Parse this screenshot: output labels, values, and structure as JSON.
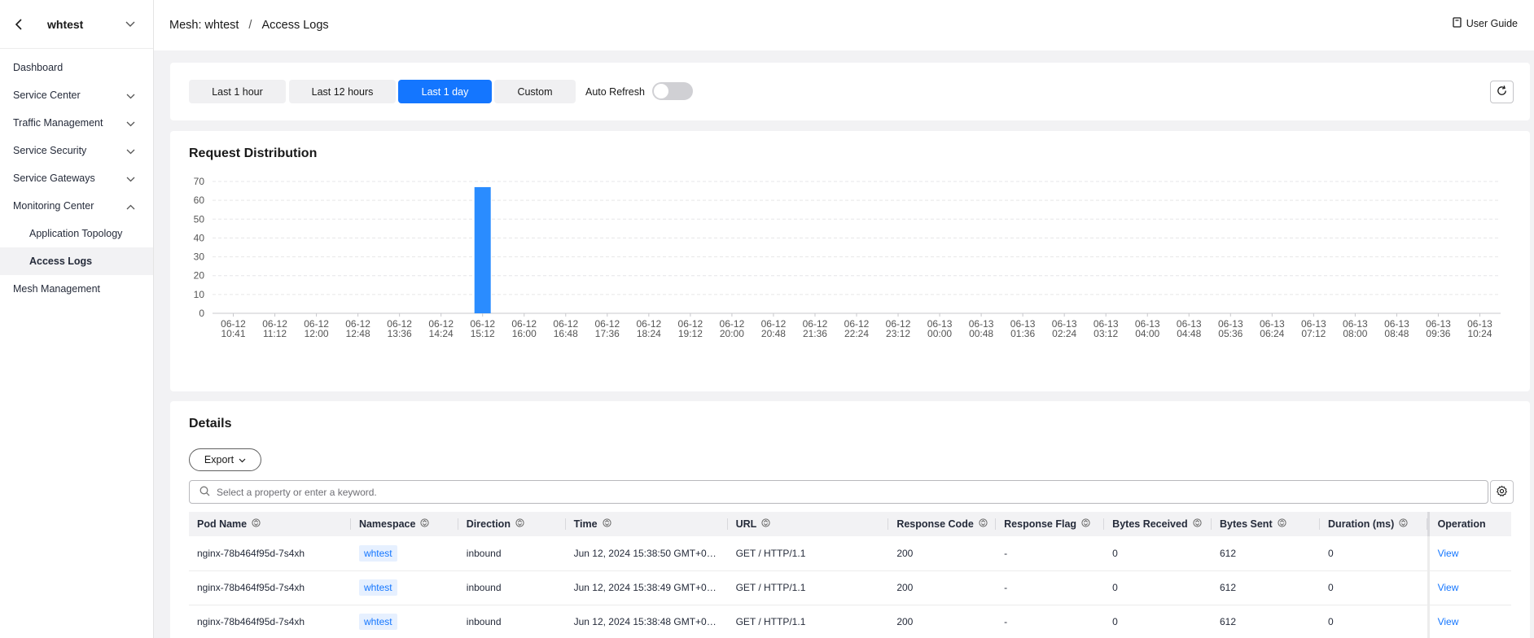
{
  "sidebar": {
    "title": "whtest",
    "items": [
      {
        "label": "Dashboard",
        "expand": ""
      },
      {
        "label": "Service Center",
        "expand": "down"
      },
      {
        "label": "Traffic Management",
        "expand": "down"
      },
      {
        "label": "Service Security",
        "expand": "down"
      },
      {
        "label": "Service Gateways",
        "expand": "down"
      },
      {
        "label": "Monitoring Center",
        "expand": "up"
      },
      {
        "label": "Application Topology",
        "sub": true
      },
      {
        "label": "Access Logs",
        "sub": true,
        "active": true
      },
      {
        "label": "Mesh Management",
        "expand": ""
      }
    ]
  },
  "breadcrumb": {
    "mesh": "Mesh: whtest",
    "separator": "/",
    "page": "Access Logs"
  },
  "user_guide": "User Guide",
  "filters": {
    "options": [
      "Last 1 hour",
      "Last 12 hours",
      "Last 1 day",
      "Custom"
    ],
    "active_index": 2,
    "auto_refresh_label": "Auto Refresh",
    "auto_refresh_on": false
  },
  "chart_section": {
    "title": "Request Distribution"
  },
  "chart_data": {
    "type": "bar",
    "title": "",
    "xlabel": "",
    "ylabel": "",
    "ylim": [
      0,
      70
    ],
    "yticks": [
      0,
      10,
      20,
      30,
      40,
      50,
      60,
      70
    ],
    "grid": true,
    "bar_color": "#2a8cff",
    "categories": [
      [
        "06-12",
        "10:41"
      ],
      [
        "06-12",
        "11:12"
      ],
      [
        "06-12",
        "12:00"
      ],
      [
        "06-12",
        "12:48"
      ],
      [
        "06-12",
        "13:36"
      ],
      [
        "06-12",
        "14:24"
      ],
      [
        "06-12",
        "15:12"
      ],
      [
        "06-12",
        "16:00"
      ],
      [
        "06-12",
        "16:48"
      ],
      [
        "06-12",
        "17:36"
      ],
      [
        "06-12",
        "18:24"
      ],
      [
        "06-12",
        "19:12"
      ],
      [
        "06-12",
        "20:00"
      ],
      [
        "06-12",
        "20:48"
      ],
      [
        "06-12",
        "21:36"
      ],
      [
        "06-12",
        "22:24"
      ],
      [
        "06-12",
        "23:12"
      ],
      [
        "06-13",
        "00:00"
      ],
      [
        "06-13",
        "00:48"
      ],
      [
        "06-13",
        "01:36"
      ],
      [
        "06-13",
        "02:24"
      ],
      [
        "06-13",
        "03:12"
      ],
      [
        "06-13",
        "04:00"
      ],
      [
        "06-13",
        "04:48"
      ],
      [
        "06-13",
        "05:36"
      ],
      [
        "06-13",
        "06:24"
      ],
      [
        "06-13",
        "07:12"
      ],
      [
        "06-13",
        "08:00"
      ],
      [
        "06-13",
        "08:48"
      ],
      [
        "06-13",
        "09:36"
      ],
      [
        "06-13",
        "10:24"
      ]
    ],
    "values": [
      0,
      0,
      0,
      0,
      0,
      0,
      67,
      0,
      0,
      0,
      0,
      0,
      0,
      0,
      0,
      0,
      0,
      0,
      0,
      0,
      0,
      0,
      0,
      0,
      0,
      0,
      0,
      0,
      0,
      0,
      0
    ]
  },
  "details": {
    "title": "Details",
    "export_label": "Export",
    "search_placeholder": "Select a property or enter a keyword.",
    "columns": [
      "Pod Name",
      "Namespace",
      "Direction",
      "Time",
      "URL",
      "Response Code",
      "Response Flag",
      "Bytes Received",
      "Bytes Sent",
      "Duration (ms)",
      "Operation"
    ],
    "rows": [
      {
        "pod": "nginx-78b464f95d-7s4xh",
        "namespace": "whtest",
        "direction": "inbound",
        "time": "Jun 12, 2024 15:38:50 GMT+0…",
        "url": "GET / HTTP/1.1",
        "code": "200",
        "flag": "-",
        "received": "0",
        "sent": "612",
        "duration": "0",
        "op": "View"
      },
      {
        "pod": "nginx-78b464f95d-7s4xh",
        "namespace": "whtest",
        "direction": "inbound",
        "time": "Jun 12, 2024 15:38:49 GMT+0…",
        "url": "GET / HTTP/1.1",
        "code": "200",
        "flag": "-",
        "received": "0",
        "sent": "612",
        "duration": "0",
        "op": "View"
      },
      {
        "pod": "nginx-78b464f95d-7s4xh",
        "namespace": "whtest",
        "direction": "inbound",
        "time": "Jun 12, 2024 15:38:48 GMT+0…",
        "url": "GET / HTTP/1.1",
        "code": "200",
        "flag": "-",
        "received": "0",
        "sent": "612",
        "duration": "0",
        "op": "View"
      }
    ]
  }
}
